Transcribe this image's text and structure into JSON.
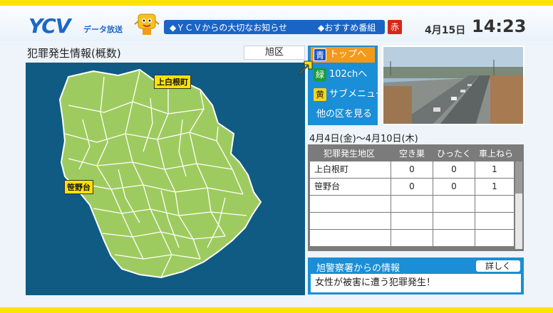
{
  "header": {
    "logo": "YCV",
    "logo_sub": "データ放送",
    "notice_1": "◆ＹＣＶからの大切なお知らせ",
    "notice_2": "◆おすすめ番組",
    "red_key": "赤",
    "date": "4月15日",
    "time": "14:23"
  },
  "map": {
    "title": "犯罪発生情報(概数)",
    "ward": "旭区",
    "labels": [
      "上白根町",
      "笹野台"
    ]
  },
  "menu": {
    "items": [
      {
        "key": "青",
        "label": "トップへ",
        "color": "#1c58c8"
      },
      {
        "key": "緑",
        "label": "102chへ",
        "color": "#1d9a3a"
      },
      {
        "key": "黄",
        "label": "サブメニュー",
        "color": "#f7d81a"
      },
      {
        "key": "",
        "label": "他の区を見る",
        "color": ""
      }
    ]
  },
  "table": {
    "period": "4月4日(金)～4月10日(木)",
    "headers": [
      "犯罪発生地区",
      "空き巣",
      "ひったくり",
      "車上ねらい"
    ],
    "rows": [
      [
        "上白根町",
        "0",
        "0",
        "1"
      ],
      [
        "笹野台",
        "0",
        "0",
        "1"
      ],
      [
        "",
        "",
        "",
        ""
      ],
      [
        "",
        "",
        "",
        ""
      ],
      [
        "",
        "",
        "",
        ""
      ]
    ]
  },
  "police": {
    "title": "旭警察署からの情報",
    "detail_button": "詳しく",
    "message": "女性が被害に遭う犯罪発生！"
  },
  "colors": {
    "accent": "#1a8ed6",
    "map_bg": "#0f5b84",
    "map_land": "#9ecb5f",
    "highlight": "#ffe300",
    "orange": "#f39a1a"
  }
}
